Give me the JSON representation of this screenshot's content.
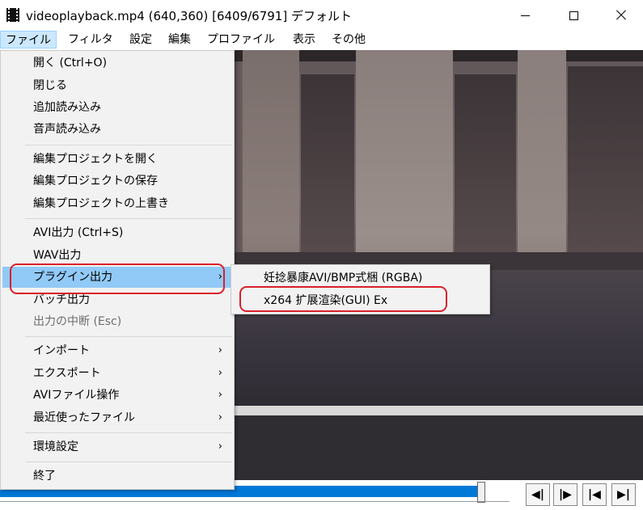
{
  "window": {
    "title": "videoplayback.mp4 (640,360)  [6409/6791]  デフォルト"
  },
  "menubar": {
    "items": [
      "ファイル",
      "フィルタ",
      "設定",
      "編集",
      "プロファイル",
      "表示",
      "その他"
    ]
  },
  "file_menu": {
    "items": [
      {
        "label": "開く (Ctrl+O)"
      },
      {
        "label": "閉じる"
      },
      {
        "label": "追加読み込み"
      },
      {
        "label": "音声読み込み"
      },
      {
        "label": "編集プロジェクトを開く"
      },
      {
        "label": "編集プロジェクトの保存"
      },
      {
        "label": "編集プロジェクトの上書き"
      },
      {
        "label": "AVI出力 (Ctrl+S)"
      },
      {
        "label": "WAV出力"
      },
      {
        "label": "プラグイン出力",
        "arrow": "›"
      },
      {
        "label": "バッチ出力"
      },
      {
        "label": "出力の中断 (Esc)"
      },
      {
        "label": "インポート",
        "arrow": "›"
      },
      {
        "label": "エクスポート",
        "arrow": "›"
      },
      {
        "label": "AVIファイル操作",
        "arrow": "›"
      },
      {
        "label": "最近使ったファイル",
        "arrow": "›"
      },
      {
        "label": "環境設定",
        "arrow": "›"
      },
      {
        "label": "終了"
      }
    ]
  },
  "plugin_submenu": {
    "items": [
      {
        "label": "妊捻暴康AVI/BMP式梱 (RGBA)"
      },
      {
        "label": "x264 扩展渲染(GUI) Ex"
      }
    ]
  },
  "playback": {
    "progress": 0.944,
    "buttons": {
      "prev_frame": "◀|",
      "next_frame": "|▶",
      "to_start": "|◀",
      "to_end": "▶|"
    }
  },
  "colors": {
    "highlight": "#91c9f7",
    "annotation": "#d9202a",
    "seek": "#0078d7"
  }
}
